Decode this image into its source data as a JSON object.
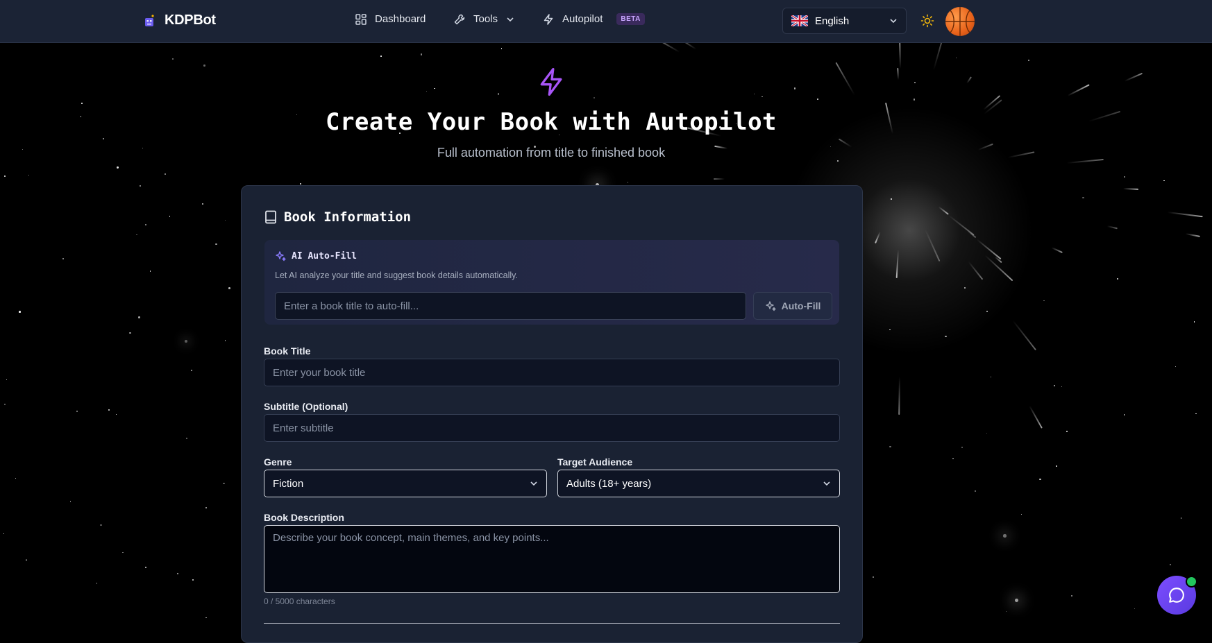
{
  "header": {
    "brand": "KDPBot",
    "nav": [
      {
        "label": "Dashboard",
        "icon": "dashboard-grid-icon"
      },
      {
        "label": "Tools",
        "icon": "wrench-icon"
      },
      {
        "label": "Autopilot",
        "icon": "lightning-icon",
        "badge": "BETA"
      }
    ],
    "language": "English",
    "language_flag": "uk-flag-icon"
  },
  "hero": {
    "title": "Create Your Book with Autopilot",
    "subtitle": "Full automation from title to finished book"
  },
  "card": {
    "title": "Book Information",
    "autofill": {
      "title": "AI Auto-Fill",
      "description": "Let AI analyze your title and suggest book details automatically.",
      "placeholder": "Enter a book title to auto-fill...",
      "button": "Auto-Fill"
    },
    "book_title": {
      "label": "Book Title",
      "placeholder": "Enter your book title"
    },
    "subtitle": {
      "label": "Subtitle (Optional)",
      "placeholder": "Enter subtitle"
    },
    "genre": {
      "label": "Genre",
      "value": "Fiction"
    },
    "audience": {
      "label": "Target Audience",
      "value": "Adults (18+ years)"
    },
    "description": {
      "label": "Book Description",
      "placeholder": "Describe your book concept, main themes, and key points...",
      "char_count": "0 / 5000 characters"
    }
  },
  "colors": {
    "accent": "#a855f7",
    "header_bg": "#1b2335",
    "card_bg": "#1a2233",
    "chat_button": "#6d45f0",
    "online": "#22c55e"
  }
}
